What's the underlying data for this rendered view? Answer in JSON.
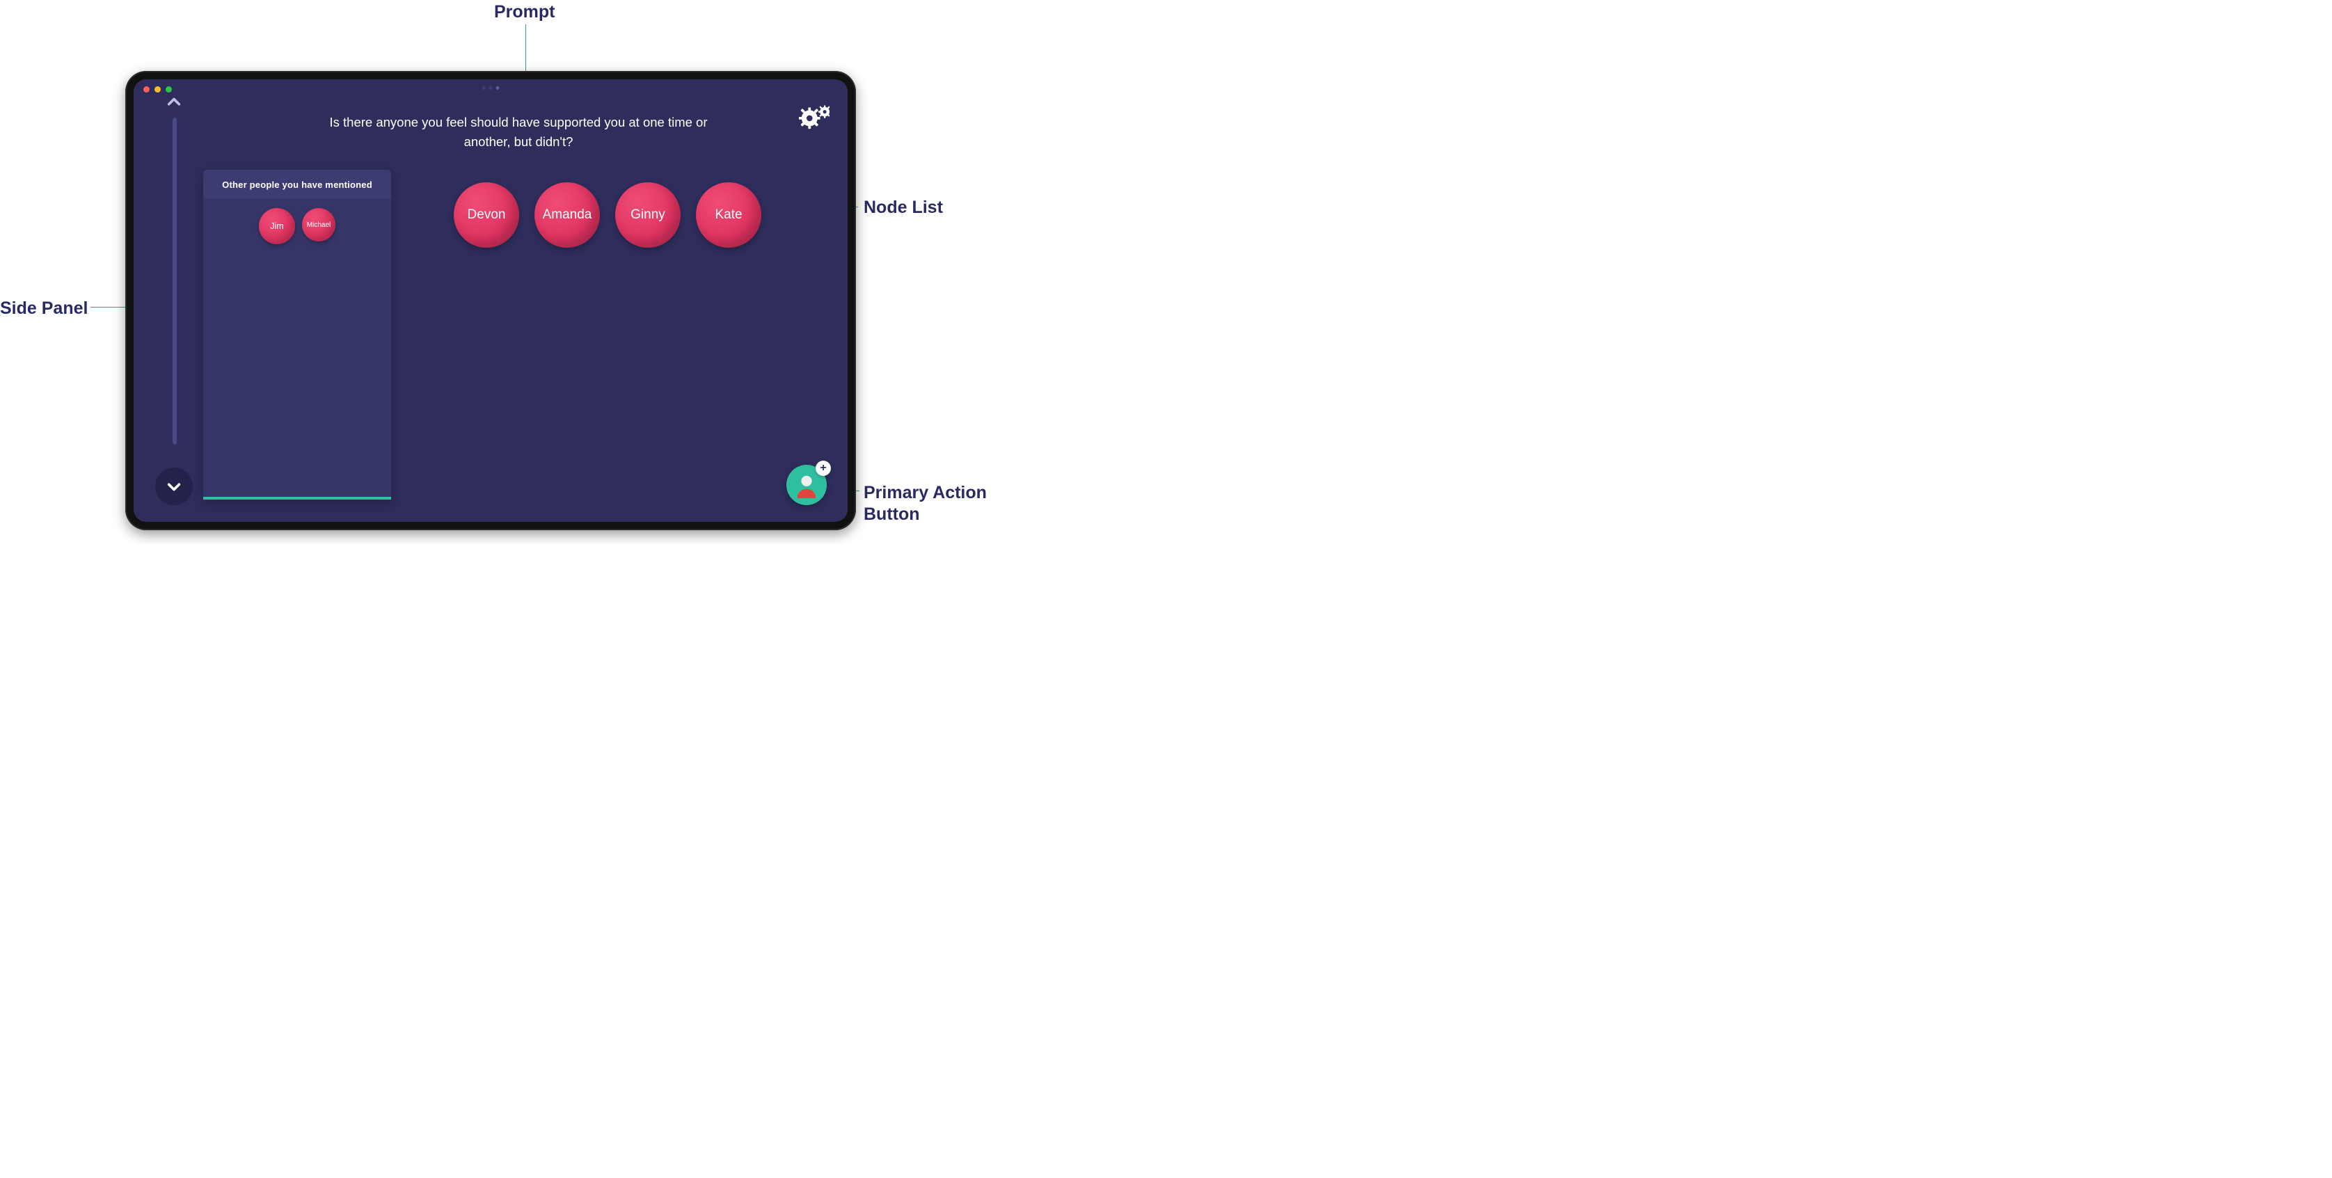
{
  "annotations": {
    "prompt": "Prompt",
    "side_panel": "Side Panel",
    "node_list": "Node List",
    "primary_action": "Primary Action\nButton"
  },
  "app": {
    "prompt_text": "Is there anyone you feel should have supported you at one time or another, but didn't?",
    "side_panel": {
      "title": "Other people you have mentioned",
      "items": [
        {
          "label": "Jim"
        },
        {
          "label": "Michael"
        }
      ]
    },
    "node_list": [
      {
        "label": "Devon"
      },
      {
        "label": "Amanda"
      },
      {
        "label": "Ginny"
      },
      {
        "label": "Kate"
      }
    ],
    "primary_action": {
      "plus_label": "+"
    }
  },
  "colors": {
    "screen_bg": "#2e2d5b",
    "panel_bg": "#363567",
    "panel_header_bg": "#3d3c72",
    "node_fill": "#e03361",
    "accent_teal": "#2fbfa0",
    "annotation_text": "#2a2a63",
    "leader_line": "#26a983"
  }
}
